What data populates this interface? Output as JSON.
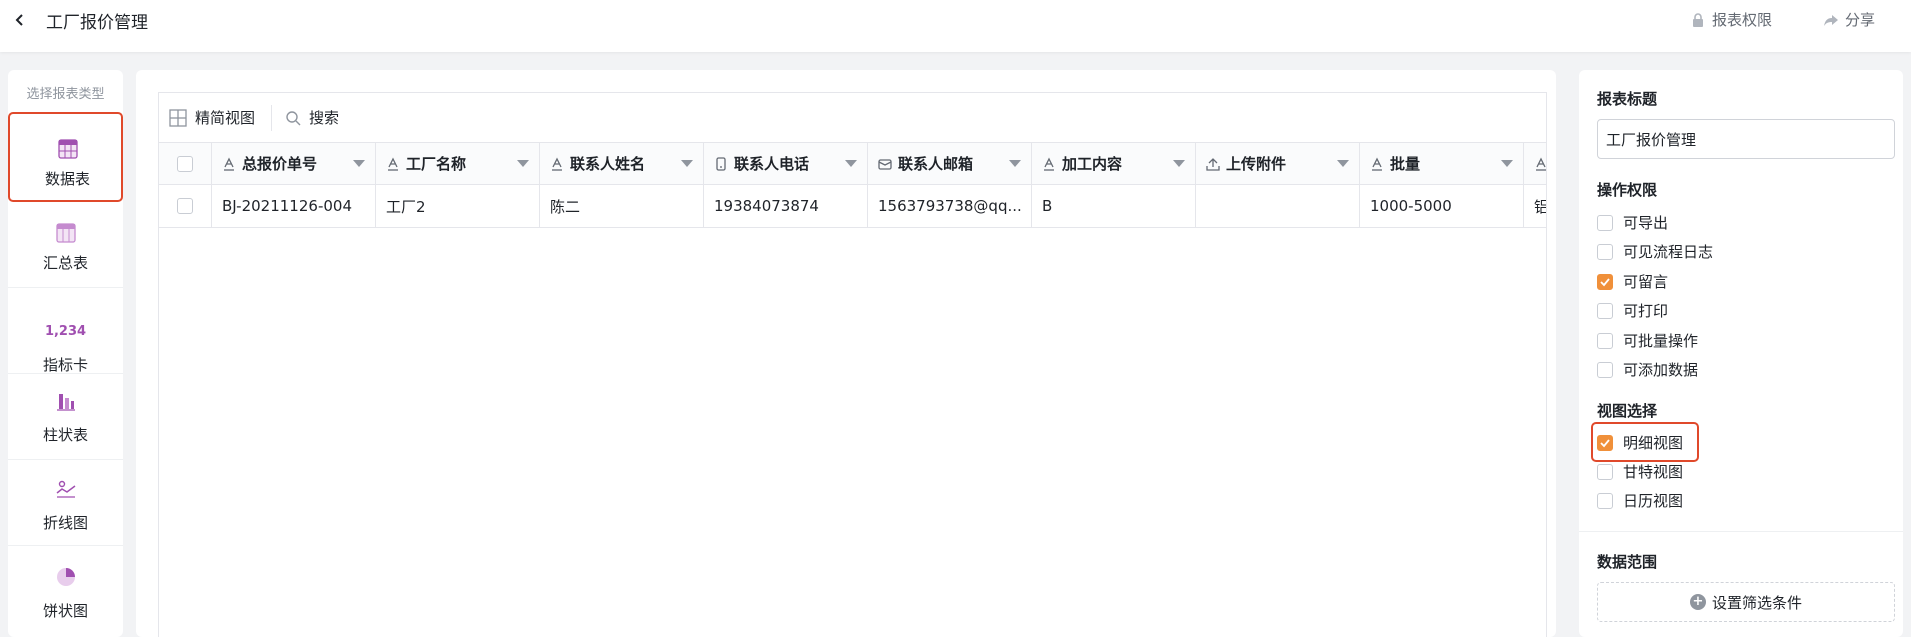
{
  "header": {
    "title": "工厂报价管理",
    "permission_label": "报表权限",
    "share_label": "分享"
  },
  "type_panel": {
    "title": "选择报表类型",
    "items": [
      {
        "label": "数据表",
        "icon": "table-icon",
        "selected": true
      },
      {
        "label": "汇总表",
        "icon": "summary-table-icon",
        "selected": false
      },
      {
        "label": "指标卡",
        "icon": "metric-card-icon",
        "icon_text": "1,234",
        "selected": false
      },
      {
        "label": "柱状表",
        "icon": "bar-chart-icon",
        "selected": false
      },
      {
        "label": "折线图",
        "icon": "line-chart-icon",
        "selected": false
      },
      {
        "label": "饼状图",
        "icon": "pie-chart-icon",
        "selected": false
      }
    ]
  },
  "toolbar": {
    "view_label": "精简视图",
    "search_label": "搜索"
  },
  "table": {
    "columns": [
      {
        "label": "总报价单号",
        "icon": "text-icon"
      },
      {
        "label": "工厂名称",
        "icon": "text-icon"
      },
      {
        "label": "联系人姓名",
        "icon": "text-icon"
      },
      {
        "label": "联系人电话",
        "icon": "phone-icon"
      },
      {
        "label": "联系人邮箱",
        "icon": "email-icon"
      },
      {
        "label": "加工内容",
        "icon": "text-icon"
      },
      {
        "label": "上传附件",
        "icon": "upload-icon"
      },
      {
        "label": "批量",
        "icon": "text-icon"
      },
      {
        "label": "",
        "icon": "text-icon"
      }
    ],
    "rows": [
      [
        "BJ-20211126-004",
        "工厂2",
        "陈二",
        "19384073874",
        "1563793738@qq...",
        "B",
        "",
        "1000-5000",
        "铝"
      ]
    ]
  },
  "settings": {
    "title_section": "报表标题",
    "title_value": "工厂报价管理",
    "ops_section": "操作权限",
    "ops": [
      {
        "label": "可导出",
        "checked": false
      },
      {
        "label": "可见流程日志",
        "checked": false
      },
      {
        "label": "可留言",
        "checked": true
      },
      {
        "label": "可打印",
        "checked": false
      },
      {
        "label": "可批量操作",
        "checked": false
      },
      {
        "label": "可添加数据",
        "checked": false
      }
    ],
    "view_section": "视图选择",
    "views": [
      {
        "label": "明细视图",
        "checked": true
      },
      {
        "label": "甘特视图",
        "checked": false
      },
      {
        "label": "日历视图",
        "checked": false
      }
    ],
    "range_section": "数据范围",
    "filter_label": "设置筛选条件"
  },
  "colors": {
    "accent": "#f0903a",
    "highlight": "#e0492b",
    "icon_purple": "#a04fb0"
  }
}
